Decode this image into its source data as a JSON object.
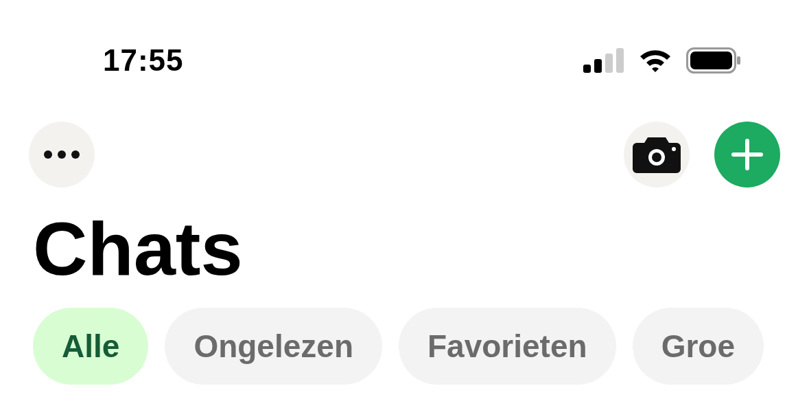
{
  "status_bar": {
    "time": "17:55"
  },
  "title": "Chats",
  "filters": [
    {
      "label": "Alle",
      "selected": true
    },
    {
      "label": "Ongelezen",
      "selected": false
    },
    {
      "label": "Favorieten",
      "selected": false
    },
    {
      "label": "Groe",
      "selected": false
    }
  ]
}
